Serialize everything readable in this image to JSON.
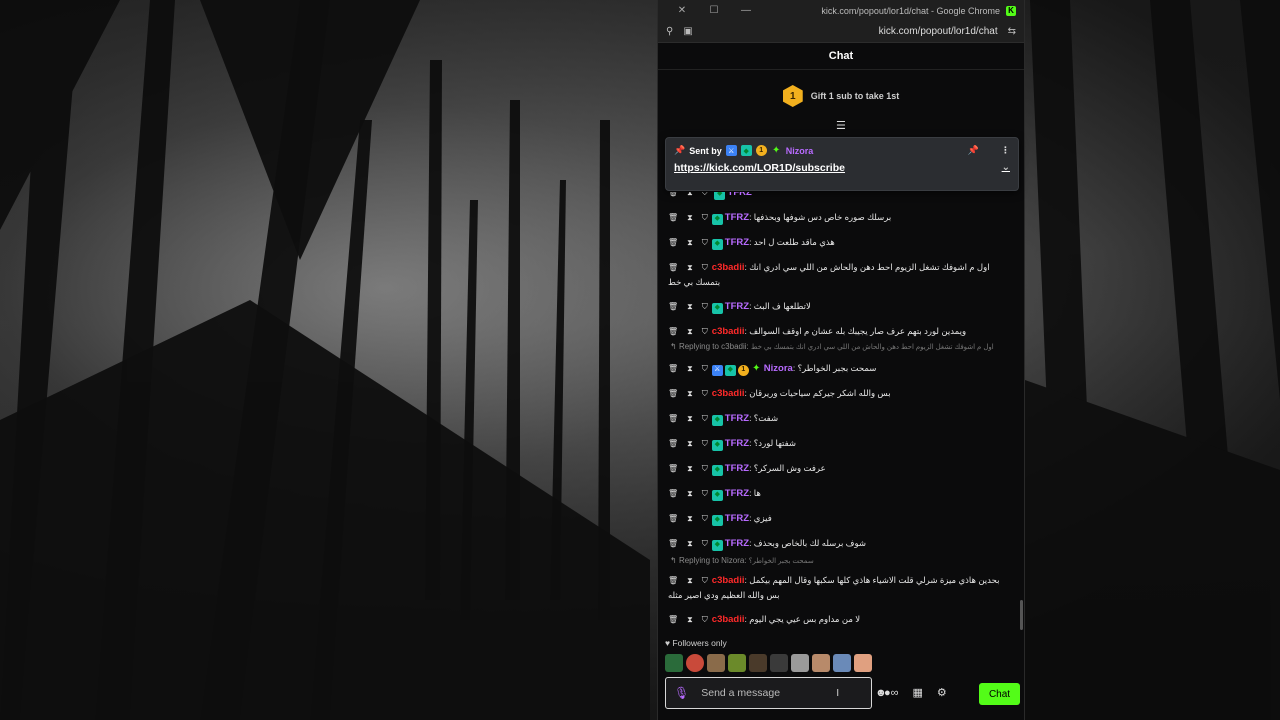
{
  "window": {
    "title": "kick.com/popout/lor1d/chat - Google Chrome",
    "address": "kick.com/popout/lor1d/chat"
  },
  "chat": {
    "header": "Chat",
    "gift": {
      "rank": "1",
      "text": "Gift 1 sub to take 1st"
    },
    "pinned": {
      "sent_by": "Sent by",
      "user": "Nizora",
      "link": "https://kick.com/LOR1D/subscribe"
    },
    "messages": [
      {
        "user": "TFRZ",
        "color": "#b86bff",
        "text": "برسلك صوره خاص دس شوفها وبحذفها"
      },
      {
        "user": "TFRZ",
        "color": "#b86bff",
        "text": "هذي ماقد طلعت ل احد"
      },
      {
        "user": "c3badii",
        "color": "#ff2a2a",
        "text": "اول م اشوفك تشغل الزيوم احط دهن والحاش من اللي سي ادري انك بتمسك بي خط"
      },
      {
        "user": "TFRZ",
        "color": "#b86bff",
        "text": "لاتطلعها ف البث"
      },
      {
        "user": "c3badii",
        "color": "#ff2a2a",
        "text": "ويمدين لورد بتهم عرف صار يجيبك بله عشان م اوقف السوالف"
      },
      {
        "user": "Nizora",
        "color": "#b86bff",
        "text": "سمحت بجبر الخواطر؟",
        "reply": "Replying to c3badii:",
        "reply_quote": "اول م اشوفك تشغل الزيوم احط دهن والحاش من اللي سي ادري انك بتمسك بي خط"
      },
      {
        "user": "c3badii",
        "color": "#ff2a2a",
        "text": "بس والله اشكر جيركم سياحيات وريرقان"
      },
      {
        "user": "TFRZ",
        "color": "#b86bff",
        "text": "شفت؟"
      },
      {
        "user": "TFRZ",
        "color": "#b86bff",
        "text": "شفتها لورد؟"
      },
      {
        "user": "TFRZ",
        "color": "#b86bff",
        "text": "عرفت وش السركر؟"
      },
      {
        "user": "TFRZ",
        "color": "#b86bff",
        "text": "ها"
      },
      {
        "user": "TFRZ",
        "color": "#b86bff",
        "text": "فيزي"
      },
      {
        "user": "TFRZ",
        "color": "#b86bff",
        "text": "شوف برسله لك بالخاص وبحذف"
      },
      {
        "user": "c3badii",
        "color": "#ff2a2a",
        "text": "بحدين هاذي ميزة شرلي قلت الاشياء هاذي كلها سكبها وقال المهم بيكمل بس والله العظيم ودي اصير مثله",
        "reply": "Replying to Nizora:",
        "reply_quote": "سمحت بجبر الخواطر؟"
      },
      {
        "user": "c3badii",
        "color": "#ff2a2a",
        "text": "لا من مداوم بس عيي يجي اليوم"
      }
    ],
    "followers_label": "Followers only",
    "composer": {
      "placeholder": "Send a message"
    },
    "send_label": "Chat"
  },
  "colors": {
    "accent": "#53fc18",
    "purple": "#b86bff",
    "red": "#ff2a2a"
  }
}
